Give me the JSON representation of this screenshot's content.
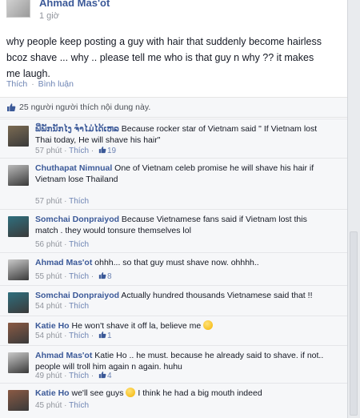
{
  "post": {
    "author": "Ahmad Mas'ot",
    "time": "1 giờ",
    "text": "why people keep posting a guy with hair that suddenly become hairless bcoz shave ... why .. please tell me who is that guy n why ?? it makes me laugh.",
    "like_label": "Thích",
    "comment_label": "Bình luận",
    "separator": "·"
  },
  "likes": {
    "text": "25 người người thích nội dung này."
  },
  "comments": [
    {
      "name": "ພີ່ພັກນັກໄງ ຈຳໄມ່ໄດ້ເຫລ",
      "text": "Because rocker star of Vietnam said \" If Vietnam lost Thai today, He will shave his hair\"",
      "time": "57 phút",
      "like_label": "Thích",
      "likes": "19",
      "avatar_color": "#7a6a52"
    },
    {
      "name": "Chuthapat Nimnual",
      "text": "One of Vietnam celeb promise he will shave his hair if Vietnam lose Thailand",
      "time": "57 phút",
      "like_label": "Thích",
      "likes": "",
      "avatar_color": "#b9b9b9"
    },
    {
      "name": "Somchai Donpraiyod",
      "text": "Because Vietnamese fans said if Vietnam lost this match . they would tonsure themselves lol",
      "time": "56 phút",
      "like_label": "Thích",
      "likes": "",
      "avatar_color": "#2f6f7e"
    },
    {
      "name": "Ahmad Mas'ot",
      "text": "ohhh... so that guy must shave now. ohhhh..",
      "time": "55 phút",
      "like_label": "Thích",
      "likes": "8",
      "avatar_color": "#c9c9c9"
    },
    {
      "name": "Somchai Donpraiyod",
      "text": "Actually hundred thousands Vietnamese said that !!",
      "time": "54 phút",
      "like_label": "Thích",
      "likes": "",
      "avatar_color": "#2f6f7e"
    },
    {
      "name": "Katie Ho",
      "text": "He won't shave it off la, believe me",
      "time": "54 phút",
      "like_label": "Thích",
      "likes": "1",
      "avatar_color": "#8a5a44",
      "emoji": true
    },
    {
      "name": "Ahmad Mas'ot",
      "text": "Katie Ho .. he must. because he already said to shave. if not.. people will troll him again n again. huhu",
      "time": "49 phút",
      "like_label": "Thích",
      "likes": "4",
      "avatar_color": "#c9c9c9"
    },
    {
      "name": "Katie Ho",
      "text": "we'll see guys",
      "text_after": "I think he had a big mouth indeed",
      "time": "45 phút",
      "like_label": "Thích",
      "likes": "",
      "avatar_color": "#8a5a44",
      "emoji": true
    }
  ],
  "colors": {
    "link_blue": "#3b5998",
    "meta_gray": "#90949c",
    "comment_bg": "#f6f7f9"
  }
}
